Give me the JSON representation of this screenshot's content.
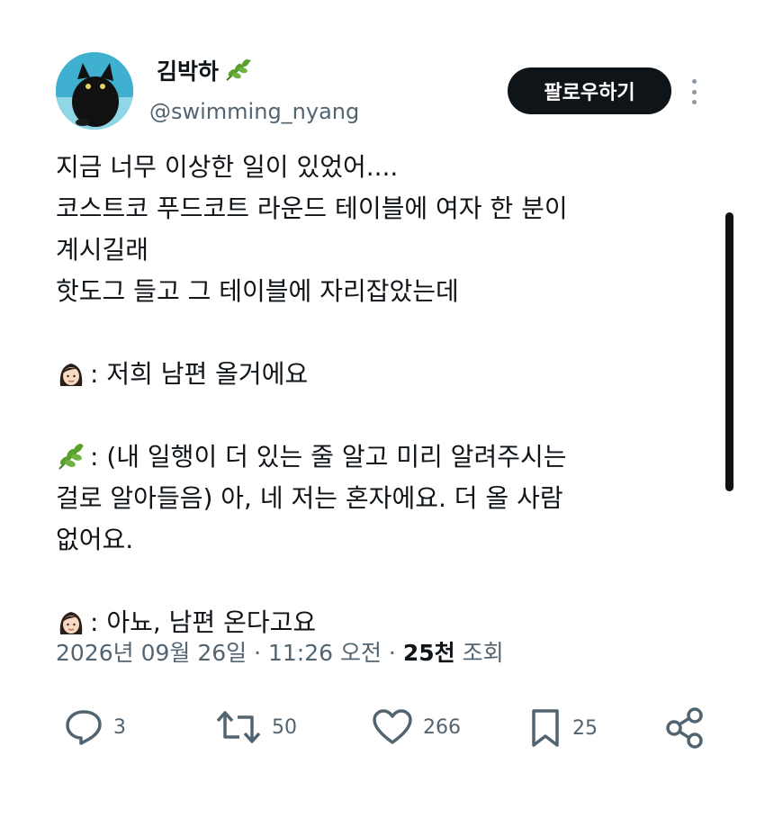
{
  "user": {
    "display_name": "김박하",
    "handle": "@swimming_nyang",
    "follow_label": "팔로우하기"
  },
  "tweet": {
    "lines": [
      "지금 너무 이상한 일이 있었어....",
      "코스트코 푸드코트 라운드 테이블에 여자 한 분이",
      "계시길래",
      "핫도그 들고 그 테이블에 자리잡았는데",
      "",
      ": 저희 남편 올거에요",
      "",
      ": (내 일행이 더 있는 줄 알고 미리 알려주시는",
      "걸로 알아들음) 아, 네 저는 혼자에요. 더 올 사람",
      "없어요.",
      "",
      ": 아뇨, 남편 온다고요"
    ]
  },
  "meta": {
    "date": "2026년 09월 26일",
    "sep1": " · ",
    "time": "11:26 오전",
    "sep2": " · ",
    "views_count": "25천",
    "views_label": " 조회"
  },
  "actions": {
    "replies": "3",
    "retweets": "50",
    "likes": "266",
    "bookmarks": "25"
  },
  "icons": {
    "avatar": "black-cat-avatar",
    "name_emoji": "herb-icon",
    "woman_emoji": "woman-face-icon",
    "herb_emoji": "herb-icon"
  },
  "colors": {
    "text": "#0f1419",
    "secondary": "#536471",
    "follow_bg": "#0f1419",
    "herb_green": "#5aa02c"
  }
}
